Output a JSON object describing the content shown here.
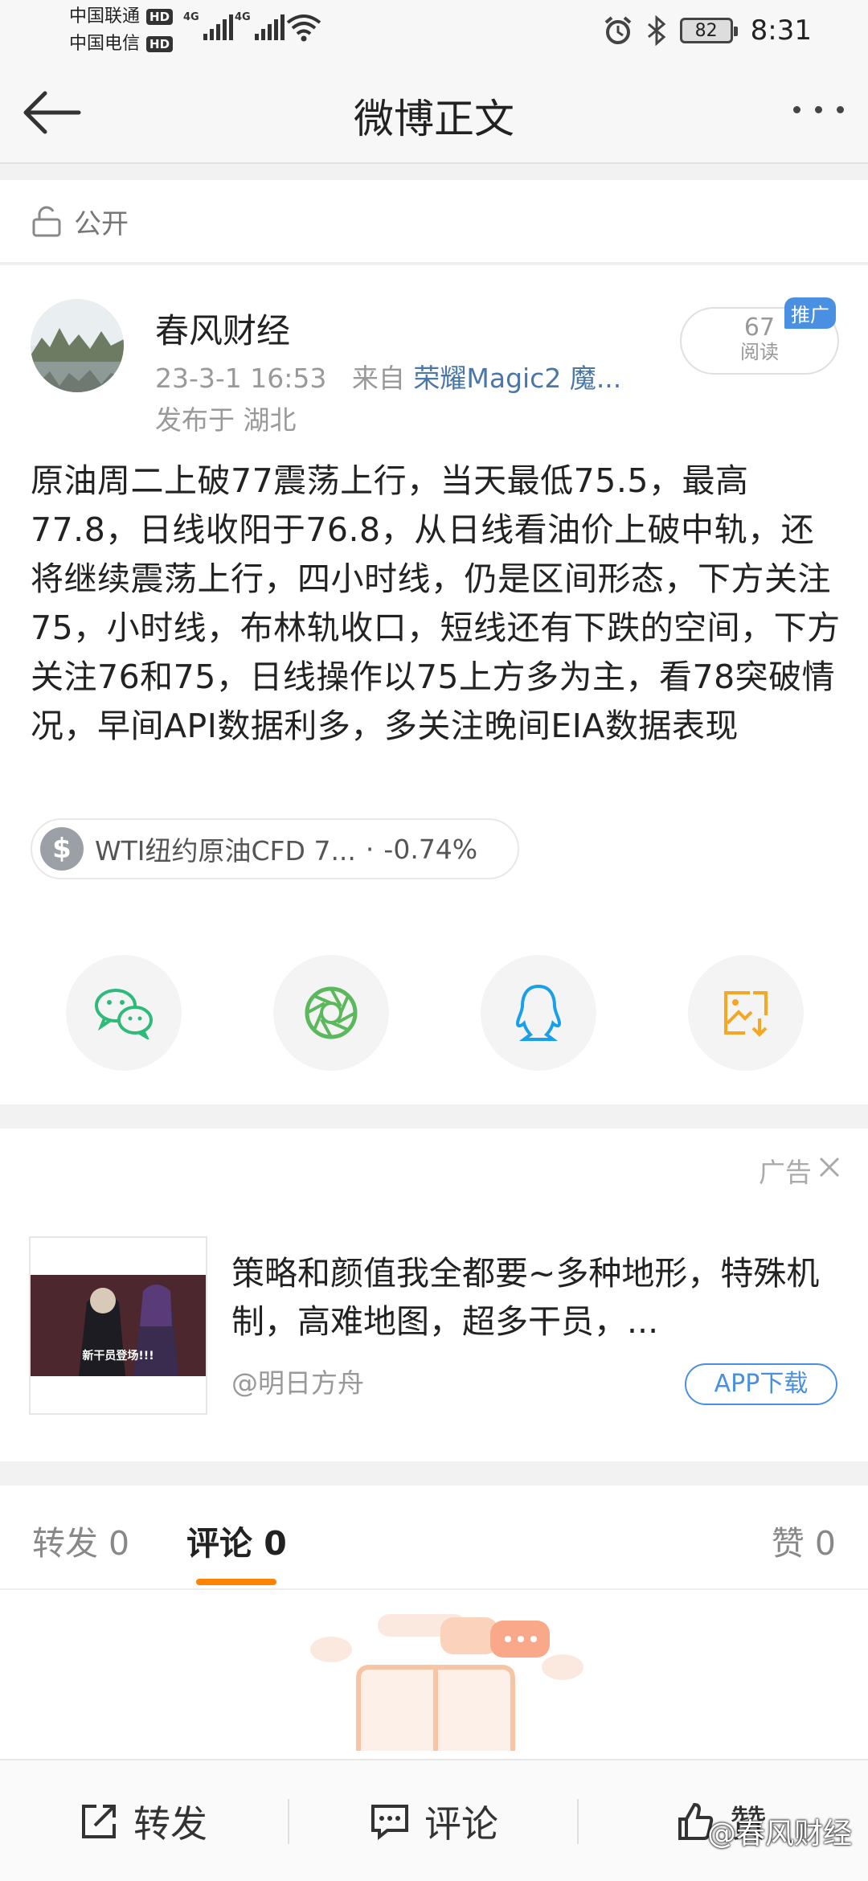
{
  "status_bar": {
    "carrier1": "中国联通",
    "carrier2": "中国电信",
    "hd": "HD",
    "net1": "4G",
    "net2": "4G",
    "battery": "82",
    "time": "8:31"
  },
  "nav": {
    "title": "微博正文"
  },
  "visibility": {
    "label": "公开"
  },
  "post": {
    "author": "春风财经",
    "date": "23-3-1 16:53",
    "from_label": "来自",
    "device": "荣耀Magic2 魔...",
    "location": "发布于 湖北",
    "read_count": "67",
    "read_label": "阅读",
    "promo_badge": "推广",
    "text": "原油周二上破77震荡上行，当天最低75.5，最高77.8，日线收阳于76.8，从日线看油价上破中轨，还将继续震荡上行，四小时线，仍是区间形态，下方关注75，小时线，布林轨收口，短线还有下跌的空间，下方关注76和75，日线操作以75上方多为主，看78突破情况，早间API数据利多，多关注晚间EIA数据表现",
    "stock_tag": {
      "symbol": "$",
      "name": "WTI纽约原油CFD 7...",
      "dot": "·",
      "change": "-0.74%"
    }
  },
  "share_icons": [
    "wechat-icon",
    "moments-icon",
    "qq-icon",
    "save-image-icon"
  ],
  "ad": {
    "label": "广告",
    "title": "策略和颜值我全都要~多种地形，特殊机制，高难地图，超多干员，...",
    "source": "@明日方舟",
    "button": "APP下载",
    "thumb_caption": "新干员登场!!!"
  },
  "tabs": {
    "repost_label": "转发",
    "repost_count": "0",
    "comment_label": "评论",
    "comment_count": "0",
    "like_label": "赞",
    "like_count": "0"
  },
  "bottom_bar": {
    "repost": "转发",
    "comment": "评论",
    "like": "赞"
  },
  "watermark": "@春风财经",
  "colors": {
    "accent": "#ff8200",
    "link": "#4a77a8",
    "blue": "#4a90e2"
  }
}
